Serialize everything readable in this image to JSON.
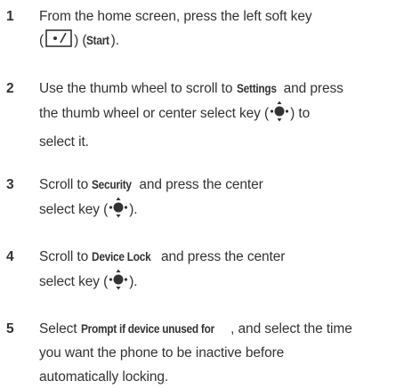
{
  "steps": [
    {
      "number": "1",
      "parts": {
        "a": "From the home screen, press the left soft key",
        "b": "(",
        "c": ") (",
        "d": "Start",
        "e": ")."
      }
    },
    {
      "number": "2",
      "parts": {
        "a": "Use the thumb wheel to scroll to ",
        "b": "Settings",
        "c": " and press",
        "d": "the thumb wheel or center select key (",
        "e": ") to",
        "f": "select it."
      }
    },
    {
      "number": "3",
      "parts": {
        "a": "Scroll to ",
        "b": "Security",
        "c": " and press the center",
        "d": "select key (",
        "e": ")."
      }
    },
    {
      "number": "4",
      "parts": {
        "a": "Scroll to ",
        "b": "Device Lock",
        "c": " and press the center",
        "d": "select key (",
        "e": ")."
      }
    },
    {
      "number": "5",
      "parts": {
        "a": "Select ",
        "b": "Prompt if device unused for",
        "c": ", and select the time",
        "d": "you want the phone to be inactive before",
        "e": "automatically locking."
      }
    }
  ]
}
